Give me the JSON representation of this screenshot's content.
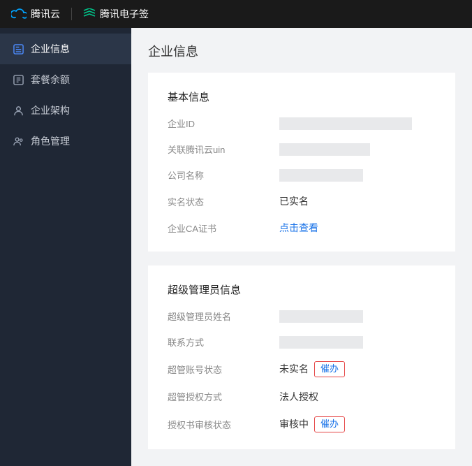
{
  "header": {
    "brand1_label": "腾讯云",
    "brand2_label": "腾讯电子签"
  },
  "sidebar": {
    "items": [
      {
        "label": "企业信息"
      },
      {
        "label": "套餐余额"
      },
      {
        "label": "企业架构"
      },
      {
        "label": "角色管理"
      }
    ]
  },
  "page": {
    "title": "企业信息"
  },
  "basic": {
    "section_title": "基本信息",
    "id_label": "企业ID",
    "uin_label": "关联腾讯云uin",
    "name_label": "公司名称",
    "verify_label": "实名状态",
    "verify_value": "已实名",
    "ca_label": "企业CA证书",
    "ca_link": "点击查看"
  },
  "admin": {
    "section_title": "超级管理员信息",
    "name_label": "超级管理员姓名",
    "contact_label": "联系方式",
    "account_status_label": "超管账号状态",
    "account_status_value": "未实名",
    "urge1_label": "催办",
    "auth_method_label": "超管授权方式",
    "auth_method_value": "法人授权",
    "auth_status_label": "授权书审核状态",
    "auth_status_value": "审核中",
    "urge2_label": "催办"
  }
}
